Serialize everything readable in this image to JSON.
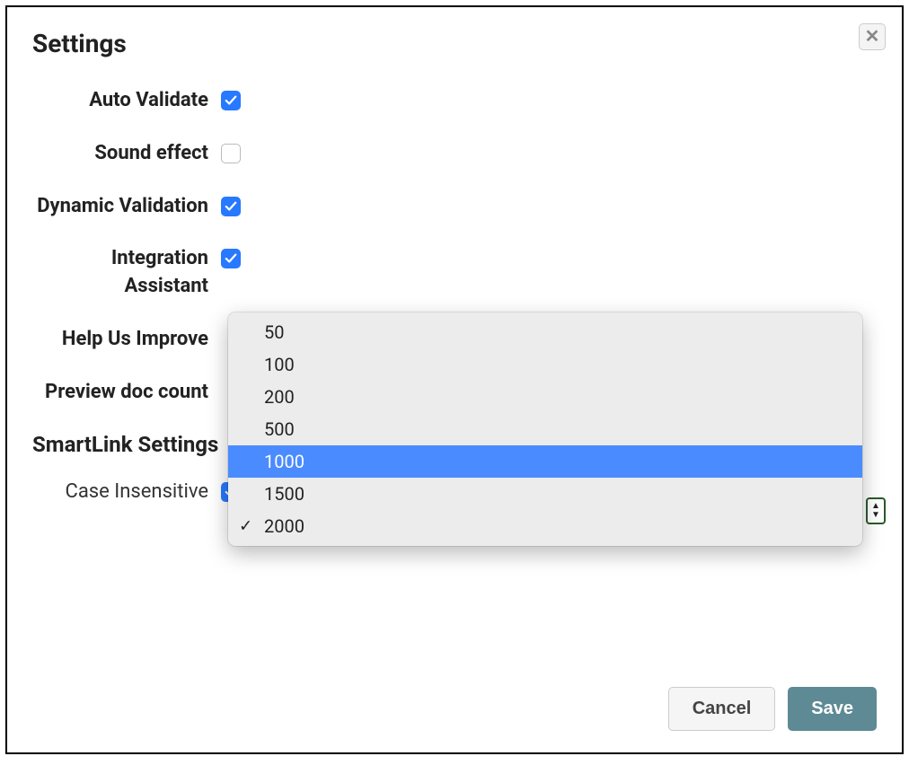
{
  "dialog": {
    "title": "Settings",
    "close_aria": "Close"
  },
  "fields": {
    "auto_validate": {
      "label": "Auto Validate",
      "checked": true
    },
    "sound_effect": {
      "label": "Sound effect",
      "checked": false
    },
    "dynamic_validation": {
      "label": "Dynamic Validation",
      "checked": true
    },
    "integration_assistant": {
      "label": "Integration Assistant",
      "checked": true
    },
    "help_us_improve": {
      "label": "Help Us Improve"
    },
    "preview_doc_count": {
      "label": "Preview doc count",
      "options": [
        "50",
        "100",
        "200",
        "500",
        "1000",
        "1500",
        "2000"
      ],
      "selected": "2000",
      "highlighted": "1000"
    }
  },
  "smartlink": {
    "section_title": "SmartLink Settings",
    "case_insensitive": {
      "label": "Case Insensitive",
      "checked": true
    }
  },
  "buttons": {
    "cancel": "Cancel",
    "save": "Save"
  }
}
